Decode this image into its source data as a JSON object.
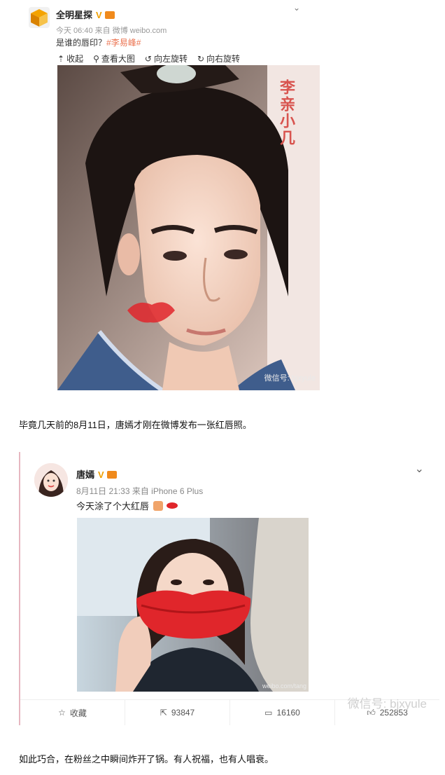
{
  "post1": {
    "author": "全明星探",
    "verified_mark": "V",
    "time_source": "今天 06:40 来自 微博 weibo.com",
    "text_plain": "是谁的唇印？",
    "hashtag": "#李易峰#",
    "toolbar": {
      "collapse": "收起",
      "view_large": "查看大图",
      "rotate_left": "向左旋转",
      "rotate_right": "向右旋转"
    },
    "image_overlay_text": "李亲小几",
    "image_watermark": "微信号: bjxyule"
  },
  "paragraph1": "毕竟几天前的8月11日，唐嫣才刚在微博发布一张红唇照。",
  "post2": {
    "author": "唐嫣",
    "verified_mark": "V",
    "time_source": "8月11日 21:33 来自 iPhone 6 Plus",
    "text": "今天涂了个大红唇",
    "image_watermark": "weibo.com/tang",
    "actions": {
      "favorite": "收藏",
      "repost_count": "93847",
      "comment_count": "16160",
      "like_count": "252853"
    },
    "wechat_watermark": "微信号: bjxyule"
  },
  "paragraph2": "如此巧合，在粉丝之中瞬间炸开了锅。有人祝福，也有人唱衰。",
  "colors": {
    "hashtag": "#eb7350",
    "verified": "#f0a000",
    "lips": "#e0262b"
  }
}
